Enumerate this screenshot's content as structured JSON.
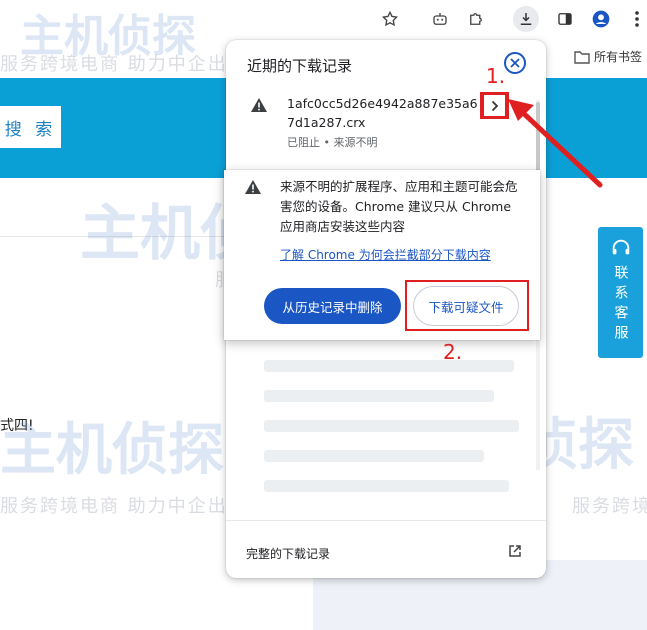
{
  "browser": {
    "toolbar_icons": [
      "star-icon",
      "extension-robot-icon",
      "puzzle-icon",
      "download-icon",
      "sidepanel-icon",
      "profile-icon",
      "menu-icon"
    ],
    "bookmark_label": "所有书签",
    "accent": "#1a56c4"
  },
  "page": {
    "search_label": "搜 索",
    "partial_text": "式四!",
    "watermark_brand": "主机侦探",
    "watermark_slogan": "服务跨境电商 助力中企出海",
    "side_service_label": "联系客服",
    "banner_color": "#0aa0d6"
  },
  "downloads": {
    "title": "近期的下载记录",
    "item": {
      "filename": "1afc0cc5d26e4942a887e35a67d1a287.crx",
      "status": "已阻止 • 来源不明"
    },
    "footer_label": "完整的下载记录"
  },
  "warning": {
    "message": "来源不明的扩展程序、应用和主题可能会危害您的设备。Chrome 建议只从 Chrome 应用商店安装这些内容",
    "link": "了解 Chrome 为何会拦截部分下载内容",
    "delete_button": "从历史记录中删除",
    "download_button": "下载可疑文件"
  },
  "annotations": {
    "step1": "1.",
    "step2": "2.",
    "color": "#e02020"
  }
}
